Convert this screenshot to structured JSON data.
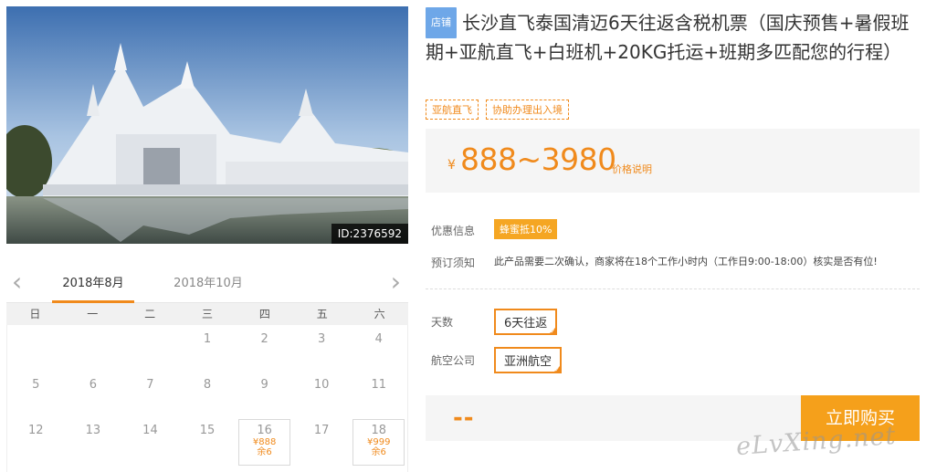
{
  "photo": {
    "id_label": "ID:2376592"
  },
  "calendar": {
    "prev_icon": "chevron-left-icon",
    "next_icon": "chevron-right-icon",
    "tabs": [
      {
        "label": "2018年8月"
      },
      {
        "label": "2018年10月"
      }
    ],
    "weekdays": [
      "日",
      "一",
      "二",
      "三",
      "四",
      "五",
      "六"
    ],
    "rows": [
      [
        {
          "day": ""
        },
        {
          "day": ""
        },
        {
          "day": ""
        },
        {
          "day": "1"
        },
        {
          "day": "2"
        },
        {
          "day": "3"
        },
        {
          "day": "4"
        }
      ],
      [
        {
          "day": "5"
        },
        {
          "day": "6"
        },
        {
          "day": "7"
        },
        {
          "day": "8"
        },
        {
          "day": "9"
        },
        {
          "day": "10"
        },
        {
          "day": "11"
        }
      ],
      [
        {
          "day": "12"
        },
        {
          "day": "13"
        },
        {
          "day": "14"
        },
        {
          "day": "15"
        },
        {
          "day": "16",
          "price": "¥888",
          "stock": "余6"
        },
        {
          "day": "17"
        },
        {
          "day": "18",
          "price": "¥999",
          "stock": "余6"
        }
      ]
    ]
  },
  "product": {
    "shop_badge": "店铺",
    "title": "长沙直飞泰国清迈6天往返含税机票（国庆预售+暑假班期+亚航直飞+白班机+20KG托运+班期多匹配您的行程）",
    "tags": [
      "亚航直飞",
      "协助办理出入境"
    ],
    "price_currency": "¥",
    "price_range": "888~3980",
    "price_note": "价格说明",
    "discount_label": "优惠信息",
    "discount_value": "蜂蜜抵10%",
    "notice_label": "预订须知",
    "notice_text": "此产品需要二次确认，商家将在18个工作小时内（工作日9:00-18:00）核实是否有位!",
    "days_label": "天数",
    "days_value": "6天往返",
    "airline_label": "航空公司",
    "airline_value": "亚洲航空",
    "qty_placeholder": "--",
    "buy_label": "立即购买"
  },
  "watermark": "eLvXing.net",
  "colors": {
    "accent": "#f08a1c",
    "buy": "#f5a01b",
    "badge": "#6ea7e8"
  }
}
